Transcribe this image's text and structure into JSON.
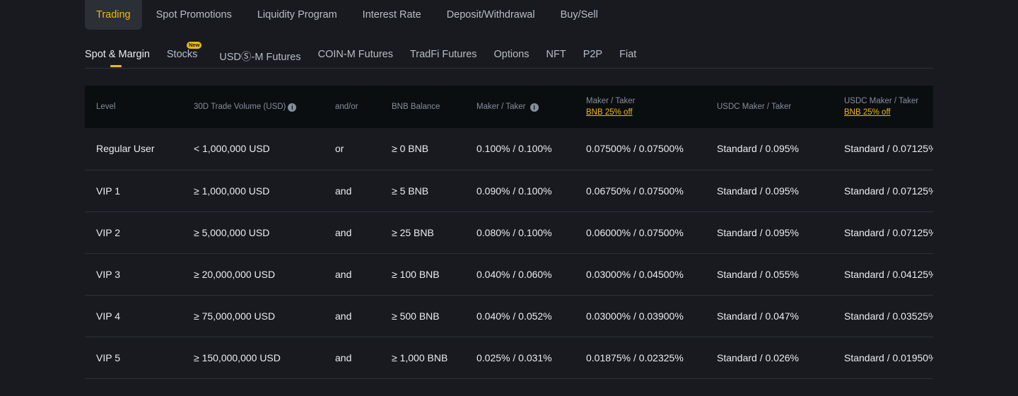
{
  "top_tabs": [
    "Trading",
    "Spot Promotions",
    "Liquidity Program",
    "Interest Rate",
    "Deposit/Withdrawal",
    "Buy/Sell"
  ],
  "sub_tabs": [
    "Spot & Margin",
    "Stocks",
    "USDⓈ-M Futures",
    "COIN-M Futures",
    "TradFi Futures",
    "Options",
    "NFT",
    "P2P",
    "Fiat"
  ],
  "new_badge": "New",
  "table": {
    "headers": {
      "level": "Level",
      "volume": "30D Trade Volume (USD)",
      "andor": "and/or",
      "bnb_balance": "BNB Balance",
      "maker_taker": "Maker / Taker",
      "maker_taker_bnb": "Maker / Taker",
      "maker_taker_bnb_sub": "BNB 25% off",
      "usdc": "USDC Maker / Taker",
      "usdc_bnb": "USDC Maker / Taker",
      "usdc_bnb_sub": "BNB 25% off"
    },
    "rows": [
      [
        "Regular User",
        "< 1,000,000 USD",
        "or",
        "≥ 0 BNB",
        "0.100% / 0.100%",
        "0.07500% / 0.07500%",
        "Standard / 0.095%",
        "Standard / 0.07125%"
      ],
      [
        "VIP 1",
        "≥ 1,000,000 USD",
        "and",
        "≥ 5 BNB",
        "0.090% / 0.100%",
        "0.06750% / 0.07500%",
        "Standard / 0.095%",
        "Standard / 0.07125%"
      ],
      [
        "VIP 2",
        "≥ 5,000,000 USD",
        "and",
        "≥ 25 BNB",
        "0.080% / 0.100%",
        "0.06000% / 0.07500%",
        "Standard / 0.095%",
        "Standard / 0.07125%"
      ],
      [
        "VIP 3",
        "≥ 20,000,000 USD",
        "and",
        "≥ 100 BNB",
        "0.040% / 0.060%",
        "0.03000% / 0.04500%",
        "Standard / 0.055%",
        "Standard / 0.04125%"
      ],
      [
        "VIP 4",
        "≥ 75,000,000 USD",
        "and",
        "≥ 500 BNB",
        "0.040% / 0.052%",
        "0.03000% / 0.03900%",
        "Standard / 0.047%",
        "Standard / 0.03525%"
      ],
      [
        "VIP 5",
        "≥ 150,000,000 USD",
        "and",
        "≥ 1,000 BNB",
        "0.025% / 0.031%",
        "0.01875% / 0.02325%",
        "Standard / 0.026%",
        "Standard / 0.01950%"
      ]
    ]
  },
  "colors": {
    "accent": "#f0b90b",
    "background": "#181a20",
    "header_bg": "#0b0e11"
  },
  "icons": {
    "info": "info-icon"
  }
}
